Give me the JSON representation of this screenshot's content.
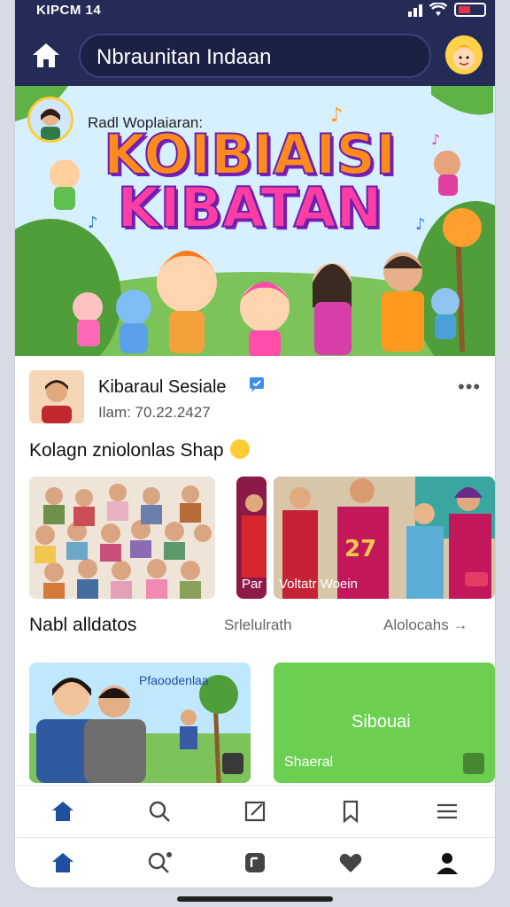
{
  "status_bar": {
    "time": "KIPCM 14"
  },
  "search": {
    "value": "Nbraunitan Indaan"
  },
  "hero": {
    "header": "Radl Woplaiaran:",
    "title_line1": "KOIBIAISI",
    "title_line2": "KIBATAN"
  },
  "post": {
    "author": "Kibaraul Sesiale",
    "time": "Ilam: 70.22.2427",
    "caption": "Kolagn zniolonlas Shap",
    "photos": [
      {
        "caption": ""
      },
      {
        "caption": "Par"
      },
      {
        "caption": "Voltatr Woein"
      }
    ]
  },
  "section": {
    "title": "Nabl alldatos",
    "meta": "Srlelulrath",
    "link": "Alolocahs →"
  },
  "cards": [
    {
      "tag": "Pfaoodenlaa"
    },
    {
      "label": "Sibouai",
      "sub": "Shaeral"
    }
  ],
  "colors": {
    "top_bar": "#252b57",
    "accent_green": "#6dcf51",
    "accent_blue": "#1f4f9e"
  }
}
